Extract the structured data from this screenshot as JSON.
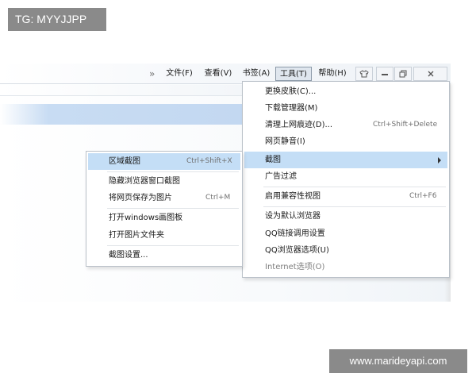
{
  "overlays": {
    "tg_label": "TG: MYYJJPP",
    "site_watermark": "www.marideyapi.com"
  },
  "menubar": {
    "more": "»",
    "items": [
      {
        "label": "文件(F)"
      },
      {
        "label": "查看(V)"
      },
      {
        "label": "书签(A)"
      },
      {
        "label": "工具(T)",
        "active": true
      },
      {
        "label": "帮助(H)"
      }
    ],
    "window_buttons": [
      "skin-icon",
      "minimize-icon",
      "restore-icon",
      "close-icon"
    ]
  },
  "tools_menu": {
    "items": [
      {
        "label": "更换皮肤(C)...",
        "shortcut": ""
      },
      {
        "label": "下载管理器(M)",
        "shortcut": ""
      },
      {
        "label": "清理上网痕迹(D)...",
        "shortcut": "Ctrl+Shift+Delete"
      },
      {
        "label": "网页静音(I)",
        "shortcut": ""
      },
      {
        "label": "截图",
        "shortcut": "",
        "submenu": true,
        "highlighted": true
      },
      {
        "label": "广告过滤",
        "shortcut": ""
      },
      {
        "label": "启用兼容性视图",
        "shortcut": "Ctrl+F6"
      },
      {
        "label": "设为默认浏览器",
        "shortcut": ""
      },
      {
        "label": "QQ链接调用设置",
        "shortcut": ""
      },
      {
        "label": "QQ浏览器选项(U)",
        "shortcut": ""
      },
      {
        "label": "Internet选项(O)",
        "shortcut": "",
        "disabled": true
      }
    ]
  },
  "screenshot_submenu": {
    "items": [
      {
        "label": "区域截图",
        "shortcut": "Ctrl+Shift+X",
        "highlighted": true
      },
      {
        "label": "隐藏浏览器窗口截图",
        "shortcut": ""
      },
      {
        "label": "将网页保存为图片",
        "shortcut": "Ctrl+M"
      },
      {
        "label": "打开windows画图板",
        "shortcut": ""
      },
      {
        "label": "打开图片文件夹",
        "shortcut": ""
      },
      {
        "label": "截图设置...",
        "shortcut": ""
      }
    ]
  },
  "colors": {
    "highlight": "#c4def6",
    "menubar_active": "#dfe6ee",
    "overlay_gray": "#8a8a8a"
  }
}
